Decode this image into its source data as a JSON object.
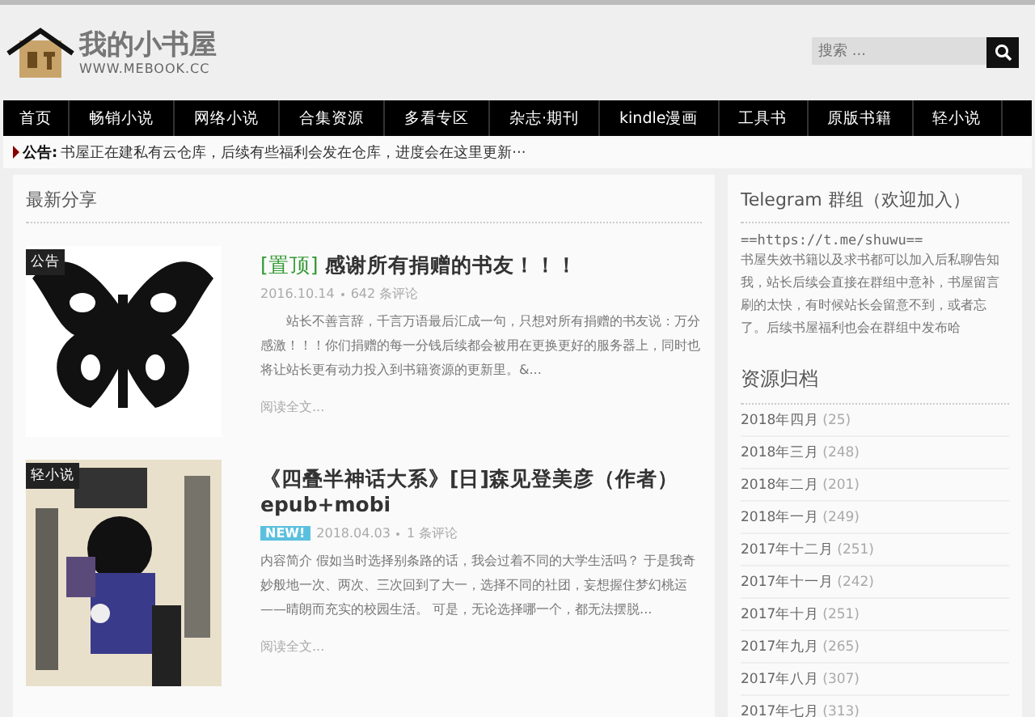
{
  "site": {
    "name": "我的小书屋",
    "url": "WWW.MEBOOK.CC"
  },
  "search": {
    "placeholder": "搜索 ..."
  },
  "nav": [
    {
      "label": "首页"
    },
    {
      "label": "畅销小说"
    },
    {
      "label": "网络小说"
    },
    {
      "label": "合集资源"
    },
    {
      "label": "多看专区"
    },
    {
      "label": "杂志·期刊"
    },
    {
      "label": "kindle漫画"
    },
    {
      "label": "工具书"
    },
    {
      "label": "原版书籍"
    },
    {
      "label": "轻小说"
    }
  ],
  "notice": {
    "label": "公告:",
    "text": "书屋正在建私有云仓库，后续有些福利会发在仓库，进度会在这里更新···"
  },
  "section_title": "最新分享",
  "posts": [
    {
      "category": "公告",
      "kind": "picture",
      "prefix": "[置顶]",
      "title": "感谢所有捐赠的书友！！！",
      "date": "2016.10.14",
      "comments": "642 条评论",
      "excerpt": "站长不善言辞，千言万语最后汇成一句，只想对所有捐赠的书友说：万分感激！！！你们捐赠的每一分钱后续都会被用在更换更好的服务器上，同时也将让站长更有动力投入到书籍资源的更新里。&...",
      "more": "阅读全文..."
    },
    {
      "category": "轻小说",
      "kind": "picture",
      "title": "《四叠半神话大系》[日]森见登美彦（作者） epub+mobi",
      "badge": "NEW!",
      "date": "2018.04.03",
      "comments": "1 条评论",
      "excerpt": "内容简介 假如当时选择别条路的话，我会过着不同的大学生活吗？ 于是我奇妙般地一次、两次、三次回到了大一，选择不同的社团，妄想握住梦幻桃运——晴朗而充实的校园生活。 可是，无论选择哪一个，都无法摆脱...",
      "more": "阅读全文..."
    }
  ],
  "telegram": {
    "title": "Telegram 群组（欢迎加入）",
    "link": "==https://t.me/shuwu==",
    "text": "书屋失效书籍以及求书都可以加入后私聊告知我，站长后续会直接在群组中意补，书屋留言刷的太快，有时候站长会留意不到，或者忘了。后续书屋福利也会在群组中发布哈"
  },
  "archive": {
    "title": "资源归档",
    "items": [
      {
        "label": "2018年四月",
        "count": "(25)"
      },
      {
        "label": "2018年三月",
        "count": "(248)"
      },
      {
        "label": "2018年二月",
        "count": "(201)"
      },
      {
        "label": "2018年一月",
        "count": "(249)"
      },
      {
        "label": "2017年十二月",
        "count": "(251)"
      },
      {
        "label": "2017年十一月",
        "count": "(242)"
      },
      {
        "label": "2017年十月",
        "count": "(251)"
      },
      {
        "label": "2017年九月",
        "count": "(265)"
      },
      {
        "label": "2017年八月",
        "count": "(307)"
      },
      {
        "label": "2017年七月",
        "count": "(313)"
      }
    ]
  }
}
